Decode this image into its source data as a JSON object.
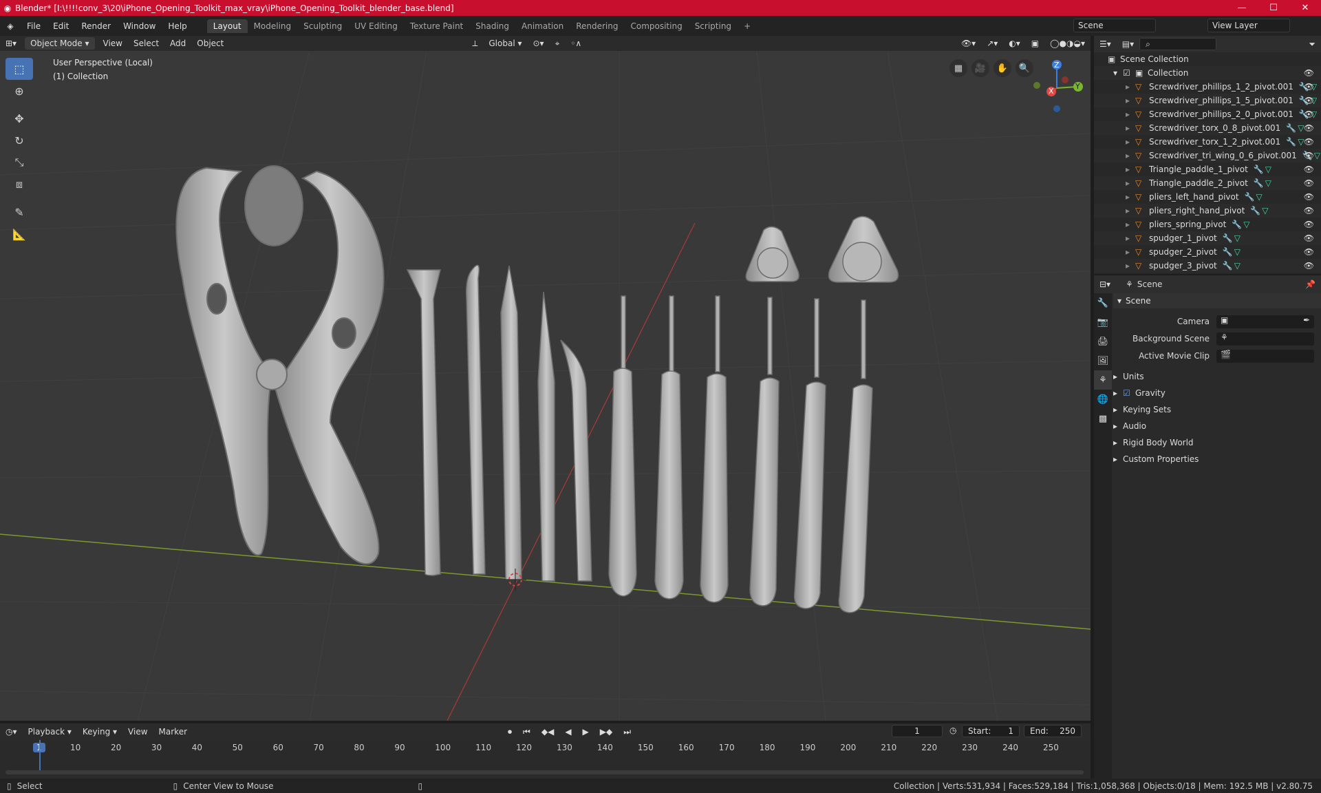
{
  "window": {
    "title": "Blender* [I:\\!!!!conv_3\\20\\iPhone_Opening_Toolkit_max_vray\\iPhone_Opening_Toolkit_blender_base.blend]",
    "minimize": "—",
    "maximize": "☐",
    "close": "✕"
  },
  "menu": [
    "File",
    "Edit",
    "Render",
    "Window",
    "Help"
  ],
  "workspaces": [
    "Layout",
    "Modeling",
    "Sculpting",
    "UV Editing",
    "Texture Paint",
    "Shading",
    "Animation",
    "Rendering",
    "Compositing",
    "Scripting"
  ],
  "add_workspace": "+",
  "scene_selector": "Scene",
  "view_layer": "View Layer",
  "viewport_header": {
    "mode": "Object Mode",
    "menus": [
      "View",
      "Select",
      "Add",
      "Object"
    ],
    "transform_orientation": "Global"
  },
  "viewport": {
    "perspective": "User Perspective (Local)",
    "collection": "(1) Collection",
    "gizmo_axes": [
      "Z",
      "Y",
      "X"
    ]
  },
  "outliner": {
    "search_placeholder": "",
    "scene_collection": "Scene Collection",
    "collection": "Collection",
    "items": [
      "Screwdriver_phillips_1_2_pivot.001",
      "Screwdriver_phillips_1_5_pivot.001",
      "Screwdriver_phillips_2_0_pivot.001",
      "Screwdriver_torx_0_8_pivot.001",
      "Screwdriver_torx_1_2_pivot.001",
      "Screwdriver_tri_wing_0_6_pivot.001",
      "Triangle_paddle_1_pivot",
      "Triangle_paddle_2_pivot",
      "pliers_left_hand_pivot",
      "pliers_right_hand_pivot",
      "pliers_spring_pivot",
      "spudger_1_pivot",
      "spudger_2_pivot",
      "spudger_3_pivot"
    ]
  },
  "properties": {
    "context": "Scene",
    "panel": "Scene",
    "fields": [
      {
        "label": "Camera"
      },
      {
        "label": "Background Scene"
      },
      {
        "label": "Active Movie Clip"
      }
    ],
    "subpanels": [
      "Units",
      "Gravity",
      "Keying Sets",
      "Audio",
      "Rigid Body World",
      "Custom Properties"
    ]
  },
  "timeline": {
    "menus": [
      "Playback",
      "Keying",
      "View",
      "Marker"
    ],
    "current_frame": "1",
    "start_label": "Start:",
    "start": "1",
    "end_label": "End:",
    "end": "250",
    "ticks": [
      "1",
      "10",
      "20",
      "30",
      "40",
      "50",
      "60",
      "70",
      "80",
      "90",
      "100",
      "110",
      "120",
      "130",
      "140",
      "150",
      "160",
      "170",
      "180",
      "190",
      "200",
      "210",
      "220",
      "230",
      "240",
      "250"
    ]
  },
  "status": {
    "left": "Select",
    "middle": "Center View to Mouse",
    "right": "Collection | Verts:531,934 | Faces:529,184 | Tris:1,058,368 | Objects:0/18 | Mem: 192.5 MB | v2.80.75"
  }
}
